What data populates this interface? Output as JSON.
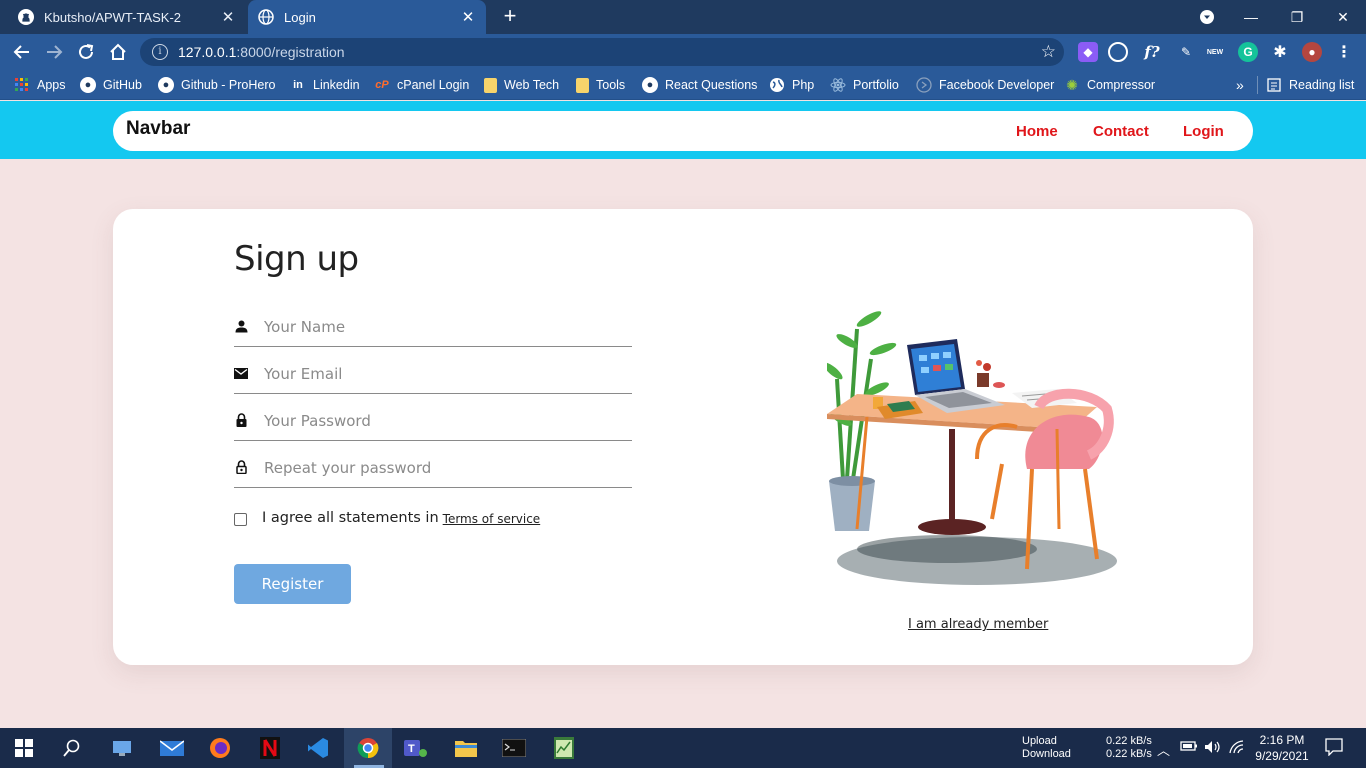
{
  "browser": {
    "tabs": [
      {
        "title": "Kbutsho/APWT-TASK-2",
        "icon": "github-icon",
        "active": false
      },
      {
        "title": "Login",
        "icon": "globe-icon",
        "active": true
      }
    ],
    "url_host": "127.0.0.1",
    "url_rest": ":8000/registration",
    "bookmarks": [
      {
        "label": "Apps",
        "icon": "apps-grid-icon"
      },
      {
        "label": "GitHub",
        "icon": "github-icon"
      },
      {
        "label": "Github - ProHero",
        "icon": "github-icon"
      },
      {
        "label": "Linkedin",
        "icon": "linkedin-icon"
      },
      {
        "label": "cPanel Login",
        "icon": "cpanel-icon"
      },
      {
        "label": "Web Tech",
        "icon": "folder-icon"
      },
      {
        "label": "Tools",
        "icon": "folder-icon"
      },
      {
        "label": "React Questions",
        "icon": "github-icon"
      },
      {
        "label": "Php",
        "icon": "globe-icon"
      },
      {
        "label": "Portfolio",
        "icon": "react-icon"
      },
      {
        "label": "Facebook Developer",
        "icon": "facebook-icon"
      },
      {
        "label": "Compressor",
        "icon": "compressor-icon"
      }
    ],
    "more_bookmarks": "»",
    "reading_list": "Reading list"
  },
  "navbar": {
    "brand": "Navbar",
    "links": [
      "Home",
      "Contact",
      "Login"
    ],
    "link_color": "#e0161a",
    "bar_color": "#14c8f0"
  },
  "form": {
    "title": "Sign up",
    "name_placeholder": "Your Name",
    "email_placeholder": "Your Email",
    "password_placeholder": "Your Password",
    "repeat_placeholder": "Repeat your password",
    "agree_text": "I agree all statements in",
    "terms_link": "Terms of service",
    "register_label": "Register",
    "register_color": "#6fa8e0",
    "member_link": "I am already member"
  },
  "taskbar": {
    "network_upload_label": "Upload",
    "network_download_label": "Download",
    "upload_rate": "0.22 kB/s",
    "download_rate": "0.22 kB/s",
    "time": "2:16 PM",
    "date": "9/29/2021"
  }
}
